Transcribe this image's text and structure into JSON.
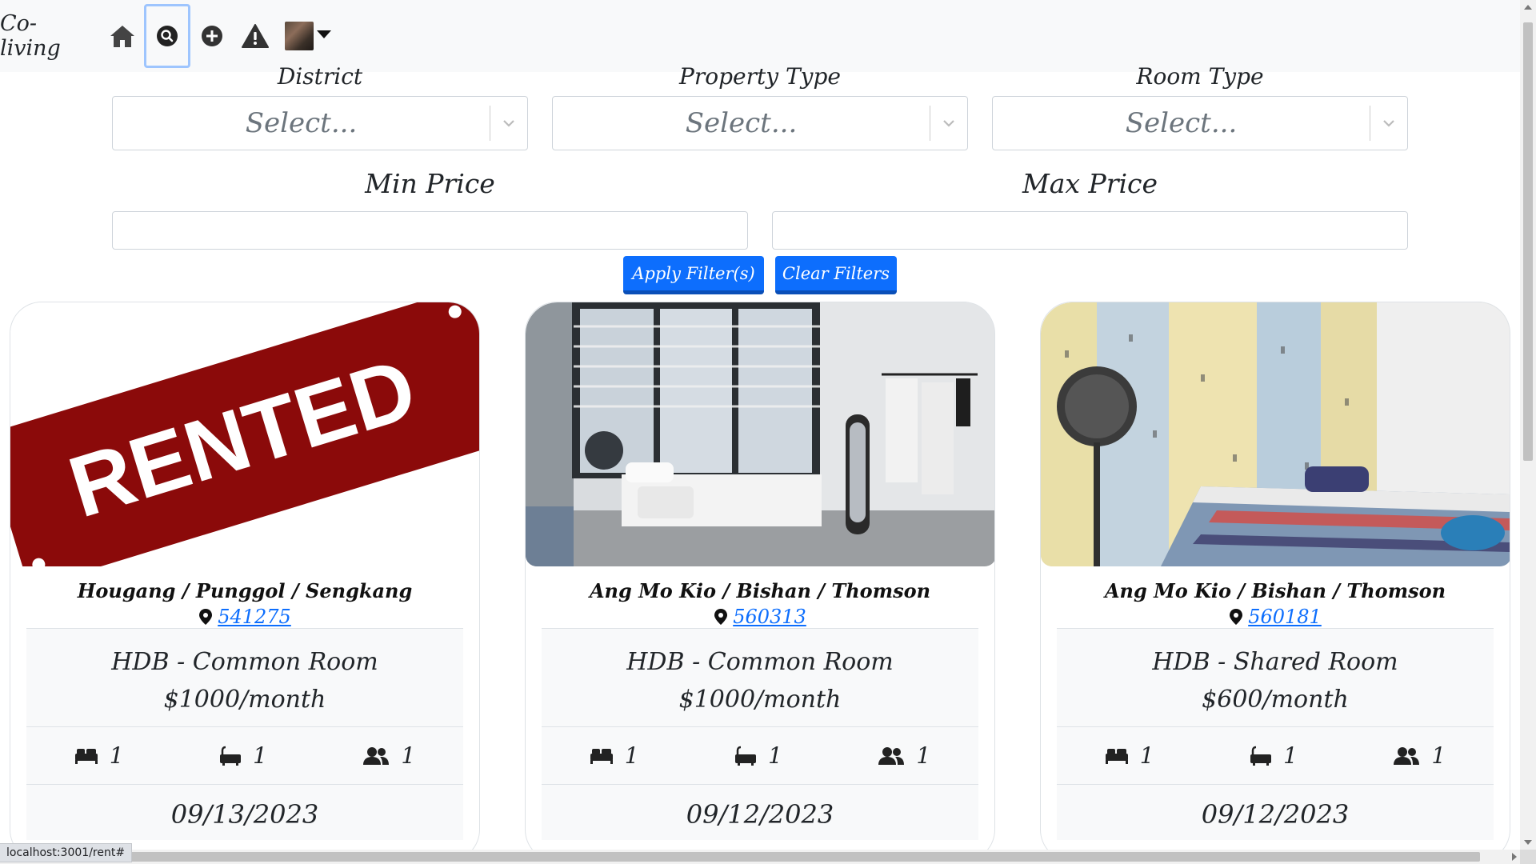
{
  "nav": {
    "brand": "Co-living",
    "items": [
      {
        "name": "home"
      },
      {
        "name": "search"
      },
      {
        "name": "add"
      },
      {
        "name": "report"
      }
    ]
  },
  "filters": {
    "district_label": "District",
    "property_type_label": "Property Type",
    "room_type_label": "Room Type",
    "select_placeholder": "Select...",
    "min_price_label": "Min Price",
    "max_price_label": "Max Price",
    "min_price_value": "",
    "max_price_value": "",
    "apply_label": "Apply Filter(s)",
    "clear_label": "Clear Filters"
  },
  "listings": [
    {
      "image_type": "rented",
      "rented_text": "RENTED",
      "location": "Hougang / Punggol / Sengkang",
      "postal": "541275",
      "type": "HDB - Common Room",
      "price": "$1000/month",
      "beds": "1",
      "baths": "1",
      "occupants": "1",
      "date": "09/13/2023"
    },
    {
      "image_type": "photo",
      "location": "Ang Mo Kio / Bishan / Thomson",
      "postal": "560313",
      "type": "HDB - Common Room",
      "price": "$1000/month",
      "beds": "1",
      "baths": "1",
      "occupants": "1",
      "date": "09/12/2023"
    },
    {
      "image_type": "photo",
      "location": "Ang Mo Kio / Bishan / Thomson",
      "postal": "560181",
      "type": "HDB - Shared Room",
      "price": "$600/month",
      "beds": "1",
      "baths": "1",
      "occupants": "1",
      "date": "09/12/2023"
    }
  ],
  "status_bar": "localhost:3001/rent#",
  "colors": {
    "primary": "#0d6efd",
    "rented_red": "#8b0a0a",
    "navbar_bg": "#f8f9fa"
  }
}
